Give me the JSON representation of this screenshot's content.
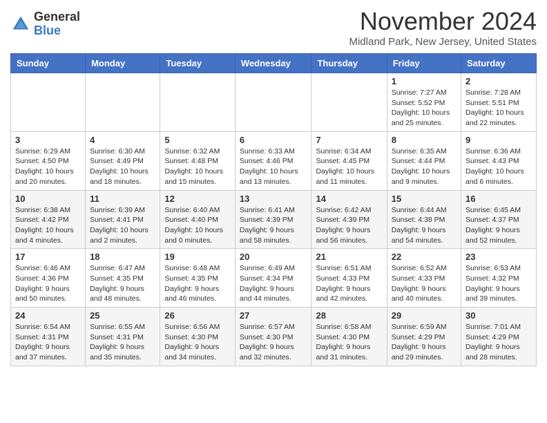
{
  "header": {
    "logo_general": "General",
    "logo_blue": "Blue",
    "month_title": "November 2024",
    "location": "Midland Park, New Jersey, United States"
  },
  "days_of_week": [
    "Sunday",
    "Monday",
    "Tuesday",
    "Wednesday",
    "Thursday",
    "Friday",
    "Saturday"
  ],
  "weeks": [
    [
      {
        "day": "",
        "info": ""
      },
      {
        "day": "",
        "info": ""
      },
      {
        "day": "",
        "info": ""
      },
      {
        "day": "",
        "info": ""
      },
      {
        "day": "",
        "info": ""
      },
      {
        "day": "1",
        "info": "Sunrise: 7:27 AM\nSunset: 5:52 PM\nDaylight: 10 hours and 25 minutes."
      },
      {
        "day": "2",
        "info": "Sunrise: 7:28 AM\nSunset: 5:51 PM\nDaylight: 10 hours and 22 minutes."
      }
    ],
    [
      {
        "day": "3",
        "info": "Sunrise: 6:29 AM\nSunset: 4:50 PM\nDaylight: 10 hours and 20 minutes."
      },
      {
        "day": "4",
        "info": "Sunrise: 6:30 AM\nSunset: 4:49 PM\nDaylight: 10 hours and 18 minutes."
      },
      {
        "day": "5",
        "info": "Sunrise: 6:32 AM\nSunset: 4:48 PM\nDaylight: 10 hours and 15 minutes."
      },
      {
        "day": "6",
        "info": "Sunrise: 6:33 AM\nSunset: 4:46 PM\nDaylight: 10 hours and 13 minutes."
      },
      {
        "day": "7",
        "info": "Sunrise: 6:34 AM\nSunset: 4:45 PM\nDaylight: 10 hours and 11 minutes."
      },
      {
        "day": "8",
        "info": "Sunrise: 6:35 AM\nSunset: 4:44 PM\nDaylight: 10 hours and 9 minutes."
      },
      {
        "day": "9",
        "info": "Sunrise: 6:36 AM\nSunset: 4:43 PM\nDaylight: 10 hours and 6 minutes."
      }
    ],
    [
      {
        "day": "10",
        "info": "Sunrise: 6:38 AM\nSunset: 4:42 PM\nDaylight: 10 hours and 4 minutes."
      },
      {
        "day": "11",
        "info": "Sunrise: 6:39 AM\nSunset: 4:41 PM\nDaylight: 10 hours and 2 minutes."
      },
      {
        "day": "12",
        "info": "Sunrise: 6:40 AM\nSunset: 4:40 PM\nDaylight: 10 hours and 0 minutes."
      },
      {
        "day": "13",
        "info": "Sunrise: 6:41 AM\nSunset: 4:39 PM\nDaylight: 9 hours and 58 minutes."
      },
      {
        "day": "14",
        "info": "Sunrise: 6:42 AM\nSunset: 4:39 PM\nDaylight: 9 hours and 56 minutes."
      },
      {
        "day": "15",
        "info": "Sunrise: 6:44 AM\nSunset: 4:38 PM\nDaylight: 9 hours and 54 minutes."
      },
      {
        "day": "16",
        "info": "Sunrise: 6:45 AM\nSunset: 4:37 PM\nDaylight: 9 hours and 52 minutes."
      }
    ],
    [
      {
        "day": "17",
        "info": "Sunrise: 6:46 AM\nSunset: 4:36 PM\nDaylight: 9 hours and 50 minutes."
      },
      {
        "day": "18",
        "info": "Sunrise: 6:47 AM\nSunset: 4:35 PM\nDaylight: 9 hours and 48 minutes."
      },
      {
        "day": "19",
        "info": "Sunrise: 6:48 AM\nSunset: 4:35 PM\nDaylight: 9 hours and 46 minutes."
      },
      {
        "day": "20",
        "info": "Sunrise: 6:49 AM\nSunset: 4:34 PM\nDaylight: 9 hours and 44 minutes."
      },
      {
        "day": "21",
        "info": "Sunrise: 6:51 AM\nSunset: 4:33 PM\nDaylight: 9 hours and 42 minutes."
      },
      {
        "day": "22",
        "info": "Sunrise: 6:52 AM\nSunset: 4:33 PM\nDaylight: 9 hours and 40 minutes."
      },
      {
        "day": "23",
        "info": "Sunrise: 6:53 AM\nSunset: 4:32 PM\nDaylight: 9 hours and 39 minutes."
      }
    ],
    [
      {
        "day": "24",
        "info": "Sunrise: 6:54 AM\nSunset: 4:31 PM\nDaylight: 9 hours and 37 minutes."
      },
      {
        "day": "25",
        "info": "Sunrise: 6:55 AM\nSunset: 4:31 PM\nDaylight: 9 hours and 35 minutes."
      },
      {
        "day": "26",
        "info": "Sunrise: 6:56 AM\nSunset: 4:30 PM\nDaylight: 9 hours and 34 minutes."
      },
      {
        "day": "27",
        "info": "Sunrise: 6:57 AM\nSunset: 4:30 PM\nDaylight: 9 hours and 32 minutes."
      },
      {
        "day": "28",
        "info": "Sunrise: 6:58 AM\nSunset: 4:30 PM\nDaylight: 9 hours and 31 minutes."
      },
      {
        "day": "29",
        "info": "Sunrise: 6:59 AM\nSunset: 4:29 PM\nDaylight: 9 hours and 29 minutes."
      },
      {
        "day": "30",
        "info": "Sunrise: 7:01 AM\nSunset: 4:29 PM\nDaylight: 9 hours and 28 minutes."
      }
    ]
  ]
}
